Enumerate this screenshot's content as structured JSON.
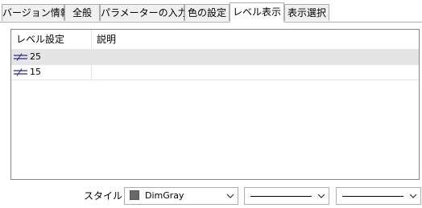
{
  "tabs": [
    {
      "label": "バージョン情報",
      "active": false
    },
    {
      "label": "全般",
      "active": false
    },
    {
      "label": "パラメーターの入力",
      "active": false
    },
    {
      "label": "色の設定",
      "active": false
    },
    {
      "label": "レベル表示",
      "active": true
    },
    {
      "label": "表示選択",
      "active": false
    }
  ],
  "levels": {
    "columns": [
      "レベル設定",
      "説明"
    ],
    "rows": [
      {
        "icon": "level-line-icon",
        "value": "25",
        "description": "",
        "selected": true
      },
      {
        "icon": "level-line-icon",
        "value": "15",
        "description": "",
        "selected": false
      }
    ]
  },
  "style": {
    "label": "スタイル：",
    "color_name": "DimGray",
    "color_hex": "#696969"
  },
  "colors": {
    "active_tab_bg": "#ffffff",
    "inactive_tab_bg": "#f0f0f0",
    "selected_row_bg": "#e5e5e5",
    "border": "#adadad"
  }
}
